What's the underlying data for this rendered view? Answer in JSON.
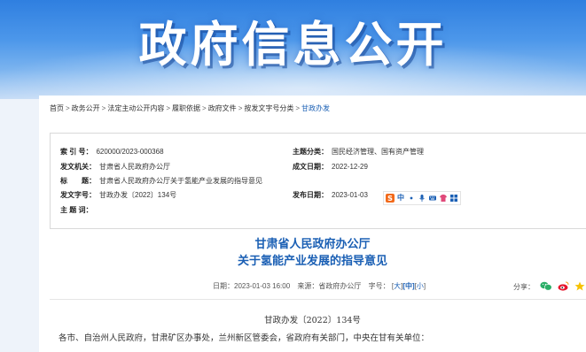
{
  "banner": {
    "title": "政府信息公开"
  },
  "breadcrumb": {
    "items": [
      "首页",
      "政务公开",
      "法定主动公开内容",
      "履职依据",
      "政府文件",
      "按发文字号分类"
    ],
    "current": "甘政办发",
    "separator": ">"
  },
  "meta": {
    "index_label": "索 引 号：",
    "index_value": "620000/2023-000368",
    "category_label": "主题分类：",
    "category_value": "国民经济管理、国有资产管理",
    "issuer_label": "发文机关：",
    "issuer_value": "甘肃省人民政府办公厅",
    "date_made_label": "成文日期：",
    "date_made_value": "2022-12-29",
    "title_label": "标　　题：",
    "title_value": "甘肃省人民政府办公厅关于氢能产业发展的指导意见",
    "doc_no_label": "发文字号：",
    "doc_no_value": "甘政办发〔2022〕134号",
    "publish_date_label": "发布日期：",
    "publish_date_value": "2023-01-03",
    "keywords_label": "主 题 词："
  },
  "toolbar": {
    "icons": [
      "sogou-icon",
      "chinese-icon",
      "dot-icon",
      "microphone-icon",
      "keyboard-icon",
      "shirt-icon",
      "grid-icon"
    ]
  },
  "document": {
    "title_line1": "甘肃省人民政府办公厅",
    "title_line2": "关于氢能产业发展的指导意见",
    "date_label": "日期：",
    "date_value": "2023-01-03 16:00",
    "source_label": "来源：",
    "source_value": "省政府办公厅",
    "font_label": "字号：",
    "font_large": "大",
    "font_medium": "中",
    "font_small": "小",
    "share_label": "分享：",
    "doc_number": "甘政办发〔2022〕134号",
    "greeting": "各市、自治州人民政府，甘肃矿区办事处，兰州新区管委会，省政府有关部门，中央在甘有关单位："
  },
  "colors": {
    "link": "#1a5fb4",
    "banner_top": "#2f7fe0"
  }
}
